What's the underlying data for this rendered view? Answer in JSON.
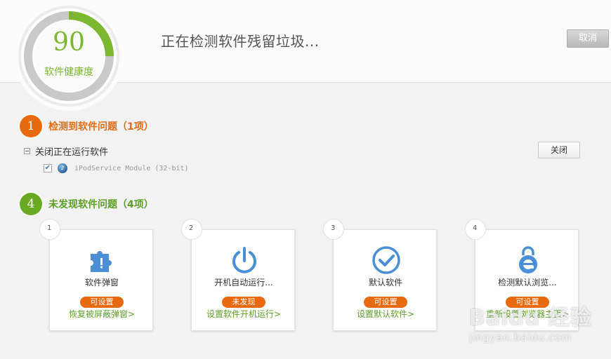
{
  "header": {
    "score": "90",
    "score_label": "软件健康度",
    "score_progress": 0.25,
    "status_text": "正在检测软件残留垃圾...",
    "cancel_label": "取消"
  },
  "colors": {
    "accent_green": "#7cb82f",
    "accent_orange": "#e86a10",
    "section_green": "#5c9f25"
  },
  "issues_found": {
    "step": "1",
    "title": "检测到软件问题（1项）",
    "group_label": "关闭正在运行软件",
    "close_label": "关闭",
    "item": {
      "name": "iPodService Module (32-bit)",
      "checked": true,
      "icon": "itunes-icon"
    }
  },
  "no_issues": {
    "step": "4",
    "title": "未发现软件问题（4项）",
    "cards": [
      {
        "index": "1",
        "icon": "puzzle-icon",
        "title": "软件弹窗",
        "badge": "可设置",
        "link": "恢复被屏蔽弹窗>"
      },
      {
        "index": "2",
        "icon": "power-icon",
        "title": "开机自动运行...",
        "badge": "未发现",
        "link": "设置软件开机运行>"
      },
      {
        "index": "3",
        "icon": "checkmark-icon",
        "title": "默认软件",
        "badge": "可设置",
        "link": "设置默认软件>"
      },
      {
        "index": "4",
        "icon": "ie-lock-icon",
        "title": "检测默认浏览...",
        "badge": "可设置",
        "link": "重新设置浏览器主页>"
      }
    ]
  },
  "watermark": {
    "logo": "Baidu 经验",
    "url": "jingyan.baidu.com"
  }
}
